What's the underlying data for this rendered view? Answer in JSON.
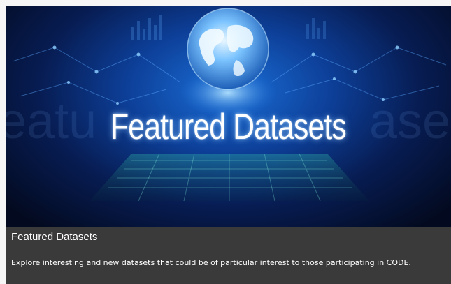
{
  "banner": {
    "title": "Featured Datasets",
    "globe_icon": "globe-icon"
  },
  "caption": {
    "title": "Featured Datasets",
    "description": "Explore interesting and new datasets that could be of particular interest to those participating in CODE."
  },
  "colors": {
    "banner_glow": "#1a6fd8",
    "banner_dark": "#030a1f",
    "caption_bg": "#3a3a3a",
    "text": "#ffffff"
  }
}
